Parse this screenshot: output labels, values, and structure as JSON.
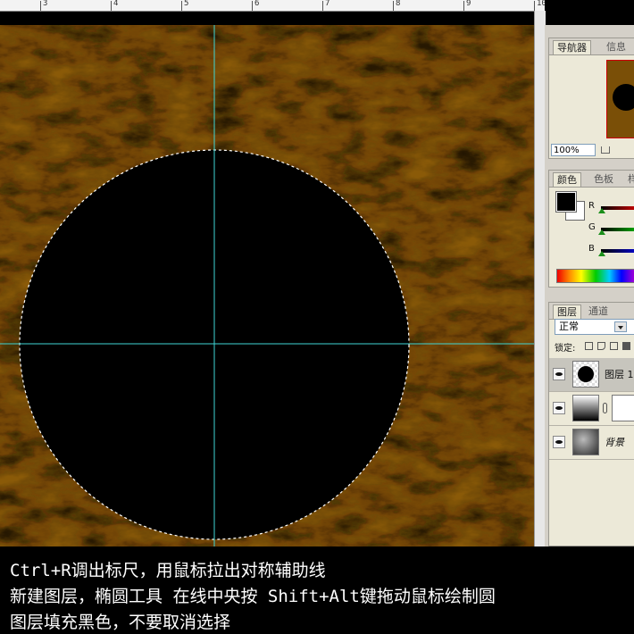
{
  "ruler": {
    "numbers": [
      "3",
      "4",
      "5",
      "6",
      "7",
      "8",
      "9",
      "10"
    ]
  },
  "panels": {
    "navigator": {
      "tabs": [
        "导航器",
        "信息"
      ],
      "zoom": "100%"
    },
    "color": {
      "tabs": [
        "颜色",
        "色板",
        "样"
      ],
      "channels": [
        "R",
        "G",
        "B"
      ],
      "foreground": "#000000",
      "background": "#ffffff"
    },
    "layers": {
      "tabs": [
        "图层",
        "通道"
      ],
      "blend_mode": "正常",
      "lock_label": "锁定:",
      "items": [
        {
          "name": "图层 1",
          "selected": true
        },
        {
          "name": "",
          "selected": false
        },
        {
          "name": "背景",
          "selected": false
        }
      ]
    }
  },
  "canvas": {
    "texture_color": "#8a5a08",
    "guide_color": "#3fd6d6",
    "selection": "circle"
  },
  "caption": {
    "line1": "Ctrl+R调出标尺，用鼠标拉出对称辅助线",
    "line2": "新建图层，椭圆工具 在线中央按 Shift+Alt键拖动鼠标绘制圆",
    "line3": "图层填充黑色，不要取消选择"
  }
}
